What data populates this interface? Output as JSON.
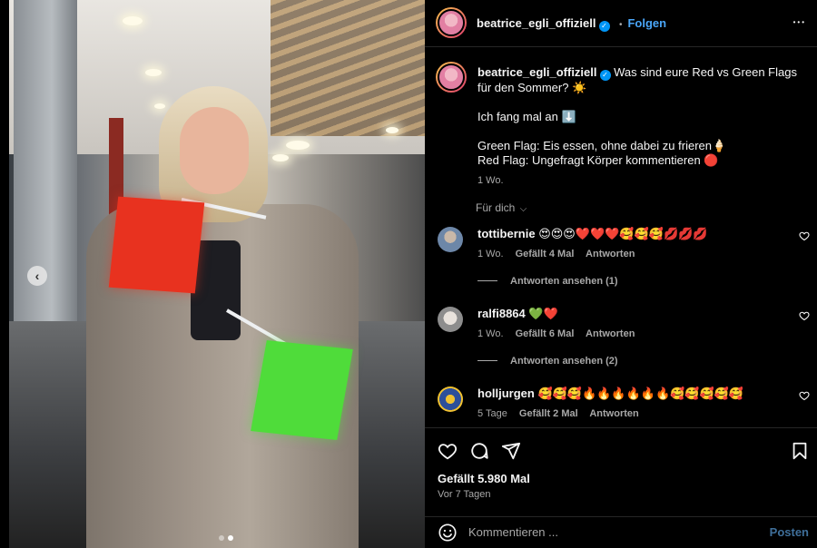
{
  "post": {
    "username": "beatrice_egli_offiziell",
    "verified_icon": "verified-badge-icon",
    "follow_label": "Folgen",
    "separator": "•",
    "more_label": "•••"
  },
  "caption": {
    "username": "beatrice_egli_offiziell",
    "line1": "Was sind eure Red vs Green Flags für den Sommer? ☀️",
    "line2": "Ich fang mal an ⬇️",
    "line3": "Green Flag: Eis essen, ohne dabei zu frieren🍦",
    "line4": "Red Flag: Ungefragt Körper kommentieren 🔴",
    "time": "1 Wo."
  },
  "filter": {
    "label": "Für dich"
  },
  "comments": [
    {
      "username": "tottibernie",
      "text": "😍😍😍❤️❤️❤️🥰🥰🥰💋💋💋",
      "time": "1 Wo.",
      "likes": "Gefällt 4 Mal",
      "reply": "Antworten",
      "view_replies": "Antworten ansehen (1)"
    },
    {
      "username": "ralfi8864",
      "text": "💚❤️",
      "time": "1 Wo.",
      "likes": "Gefällt 6 Mal",
      "reply": "Antworten",
      "view_replies": "Antworten ansehen (2)"
    },
    {
      "username": "holljurgen",
      "text": "🥰🥰🥰🔥🔥🔥🔥🔥🔥🥰🥰🥰🥰🥰",
      "time": "5 Tage",
      "likes": "Gefällt 2 Mal",
      "reply": "Antworten"
    }
  ],
  "stats": {
    "likes": "Gefällt 5.980 Mal",
    "date": "Vor 7 Tagen"
  },
  "composer": {
    "placeholder": "Kommentieren ...",
    "post_label": "Posten"
  },
  "colors": {
    "accent_blue": "#0095f6",
    "follow_blue": "#4aa6f8",
    "background": "#000000"
  }
}
